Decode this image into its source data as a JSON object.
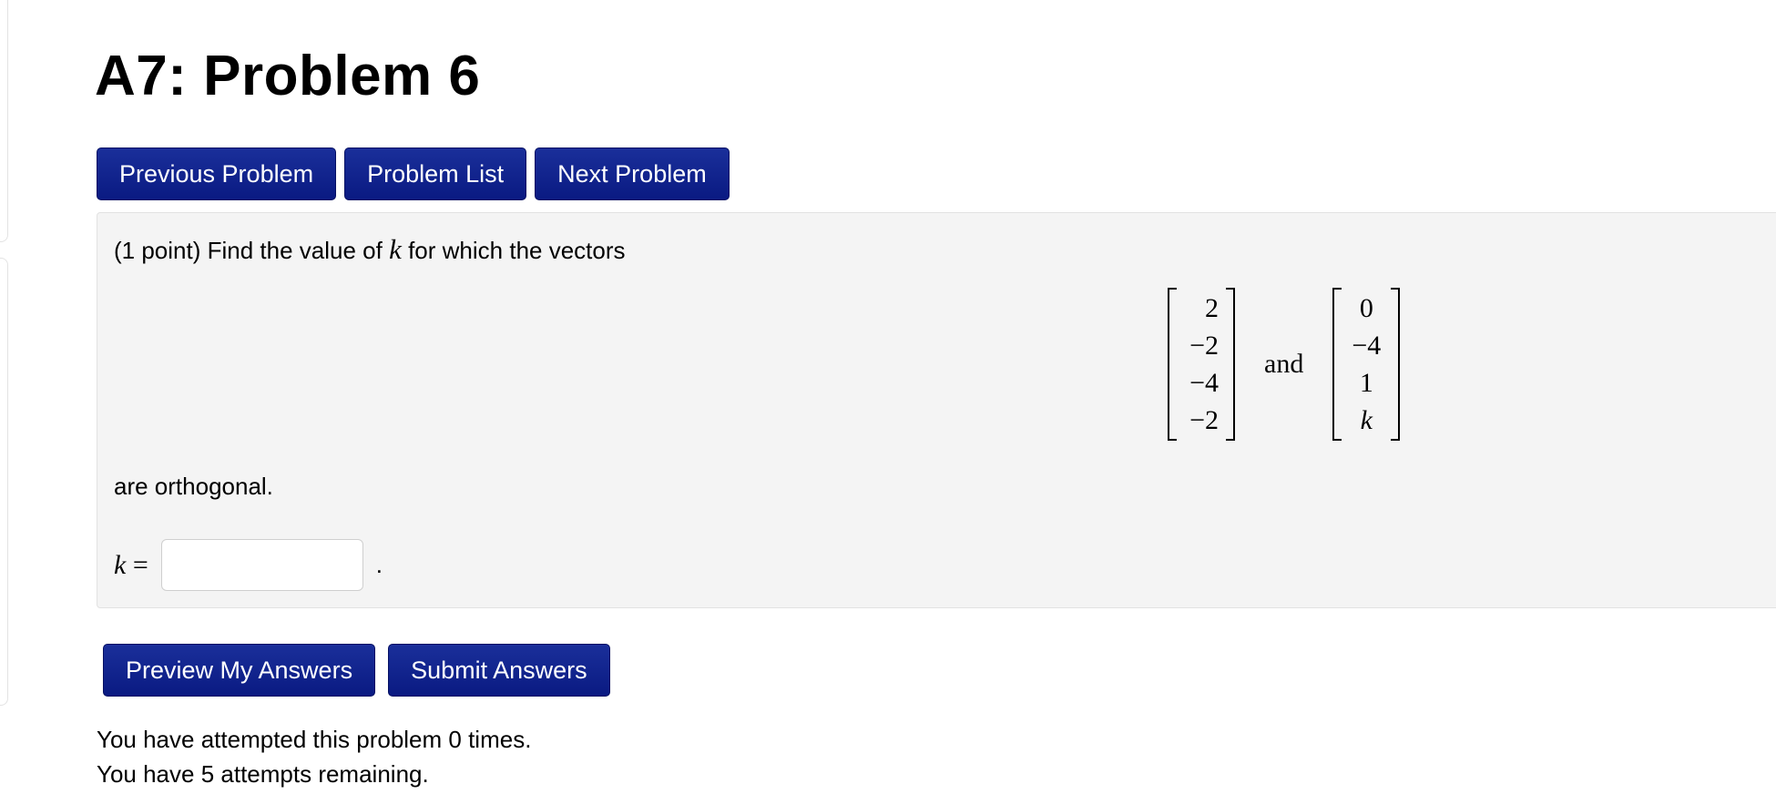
{
  "page": {
    "title": "A7: Problem 6"
  },
  "nav": {
    "previous": "Previous Problem",
    "list": "Problem List",
    "next": "Next Problem"
  },
  "problem": {
    "intro_prefix": "(1 point) Find the value of",
    "variable": "k",
    "intro_suffix": "for which the vectors",
    "vector_a": [
      "2",
      "−2",
      "−4",
      "−2"
    ],
    "conjunction": "and",
    "vector_b": [
      "0",
      "−4",
      "1",
      "k"
    ],
    "outro": "are orthogonal.",
    "answer_label_var": "k",
    "answer_label_eq": "=",
    "answer_value": "",
    "answer_suffix": "."
  },
  "actions": {
    "preview": "Preview My Answers",
    "submit": "Submit Answers"
  },
  "status": {
    "attempts": "You have attempted this problem 0 times.",
    "remaining": "You have 5 attempts remaining."
  }
}
